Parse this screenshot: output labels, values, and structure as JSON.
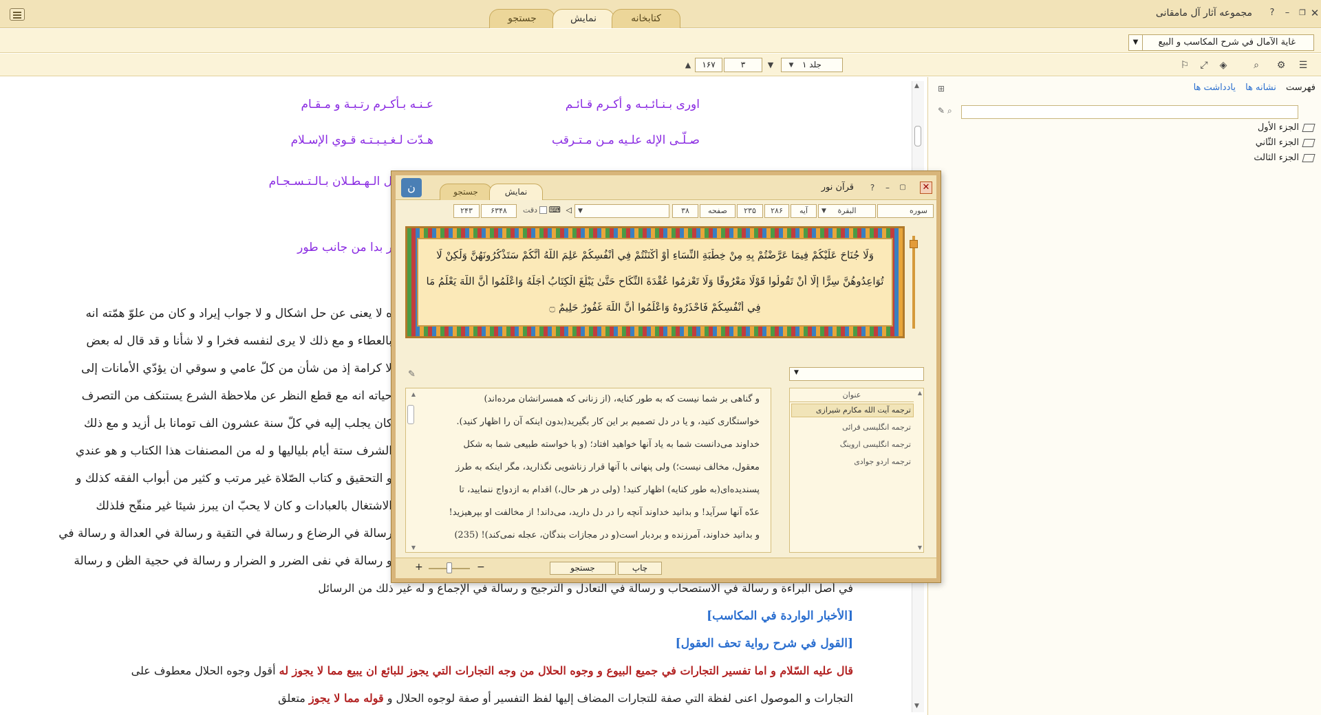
{
  "app": {
    "title": "مجموعه آثار آل مامقانی",
    "tabs": [
      "کتابخانه",
      "نمایش",
      "جستجو"
    ],
    "active_tab": "نمایش"
  },
  "book": {
    "selected": "غاية الآمال في شرح المكاسب و البيع"
  },
  "toolbar": {
    "volume": "جلد ۱",
    "page": "۳",
    "total_pages": "۱۶۷"
  },
  "side_panel": {
    "tabs": [
      "فهرست",
      "نشانه ها",
      "یادداشت ها"
    ],
    "tree": [
      "الجزء الأول",
      "الجزء الثّاني",
      "الجزء الثالث"
    ]
  },
  "reader": {
    "poem": [
      {
        "right": "اوری بـنـائـبـه و أکـرم قـائـم",
        "left": "عـنـه بـأکـرم رتـبـة و مـقـام"
      },
      {
        "right": "صـلّـی الإله علـیه مـن مـتـرقب",
        "left": "هـدّت لـغـیـبـتـه قـوي الإسـلام"
      },
      {
        "right": "",
        "left": "ل الـهـطـلان بـالـتـسـجـام"
      }
    ],
    "fragment": "ر بدا من جانب طور",
    "paragraph": [
      "ه لا يعنى عن حل اشكال و لا جواب إيراد و كان من علوّ همّته انه",
      "بالعطاء و مع ذلك لا يرى لنفسه فخرا و لا شأنا و قد قال له بعض",
      "لا كرامة إذ من شأن من كلّ عامي و سوقي ان يؤدّي الأمانات إلى",
      "حياته انه مع قطع النظر عن ملاحظة الشرع يستنكف من التصرف",
      "كان يجلب إليه في كلّ سنة عشرون الف تومانا بل أزيد و مع ذلك",
      "الشرف ستة أيام بلياليها و له من المصنفات هذا الكتاب و هو عندي",
      "و التحقيق و كتاب الصّلاة غير مرتب و كثير من أبواب الفقه كذلك و",
      "الاشتغال بالعبادات و كان لا يحبّ ان يبرز شيئا غير منقّح فلذلك",
      "رسالة في الرضاع و رسالة في التقية و رسالة في العدالة و رسالة في",
      "و رسالة في نفى الضرر و الضرار و رسالة في حجية الظن و رسالة"
    ],
    "full_line": "في أصل البراءة و رسالة في الاستصحاب و رسالة في التعادل و الترجيح و رسالة في الإجماع و له غير ذلك من الرسائل",
    "heading1": "[الأخبار الواردة في المكاسب]",
    "heading2": "[القول في شرح رواية تحف العقول]",
    "red_line": "قال عليه السّلام و اما تفسير التجارات في جميع البيوع و وجوه الحلال من وجه التجارات التي يجوز للبائع ان يبيع مما لا يجوز له",
    "red_line_tail": "أقول وجوه الحلال معطوف على",
    "last_line_black": "التجارات و الموصول اعنى لفظة التي صفة للتجارات المضاف إليها لفظ التفسير أو صفة لوجوه الحلال و",
    "last_line_red": "قوله مما لا يجوز",
    "last_line_tail": "متعلق"
  },
  "quran_window": {
    "title": "قرآن نور",
    "tabs": [
      "نمایش",
      "جستجو"
    ],
    "active_tab": "نمایش",
    "nav": {
      "sura_label": "سوره",
      "sura_value": "البقرة",
      "aya_label": "آیه",
      "aya_value": "۲۳۵",
      "aya_total": "۲۸۶",
      "page_label": "صفحه",
      "page_value": "۳۸",
      "precise_label": "دقت",
      "num_a": "۶۳۴۸",
      "num_b": "۲۴۳"
    },
    "ayah_lines": [
      "وَلَا جُنَاحَ عَلَيْكُمْ فِيمَا عَرَّضْتُمْ بِهِ مِنْ خِطْبَةِ النِّسَاءِ أَوْ أَكْنَنْتُمْ فِي أَنْفُسِكُمْ عَلِمَ اللَّهُ أَنَّكُمْ سَتَذْكُرُونَهُنَّ وَلَٰكِنْ لَا",
      "تُوَاعِدُوهُنَّ سِرًّا إِلَّا أَنْ تَقُولُوا قَوْلًا مَعْرُوفًا وَلَا تَعْزِمُوا عُقْدَةَ النِّكَاحِ حَتَّىٰ يَبْلُغَ الْكِتَابُ أَجَلَهُ وَاعْلَمُوا أَنَّ اللَّهَ يَعْلَمُ مَا",
      "فِي أَنْفُسِكُمْ فَاحْذَرُوهُ وَاعْلَمُوا أَنَّ اللَّهَ غَفُورٌ حَلِيمٌ ۝"
    ],
    "translation_list_header": "عنوان",
    "translations": [
      "ترجمه آیت الله مکارم شیرازی",
      "ترجمه انگلیسی قرائی",
      "ترجمه انگلیسی اروینگ",
      "ترجمه اردو جوادی"
    ],
    "selected_translation": "ترجمه آیت الله مکارم شیرازی",
    "translation_text": [
      "و گناهی بر شما نیست که به طور کنایه، (از زنانی که همسرانشان مرده‌اند)",
      "خواستگاری کنید، و یا در دل تصمیم بر این کار بگیرید(بدون اینکه آن را اظهار کنید).",
      "خداوند می‌دانست شما به یاد آنها خواهید افتاد؛ (و با خواسته طبیعی شما به شکل",
      "معقول، مخالف نیست؛) ولی پنهانی با آنها قرار زناشویی نگذارید، مگر اینکه به طرز",
      "پسندیده‌ای(به طور کنایه) اظهار کنید! (ولی در هر حال،) اقدام به ازدواج ننمایید، تا",
      "عدّه آنها سرآید! و بدانید خداوند آنچه را در دل دارید، می‌داند! از مخالفت او بپرهیزید!",
      "و بدانید خداوند، آمرزنده و بردبار است(و در مجازات بندگان، عجله نمی‌کند)! (235)"
    ],
    "buttons": {
      "search": "جستجو",
      "print": "چاپ"
    },
    "zoom_minus": "−",
    "zoom_plus": "+"
  }
}
